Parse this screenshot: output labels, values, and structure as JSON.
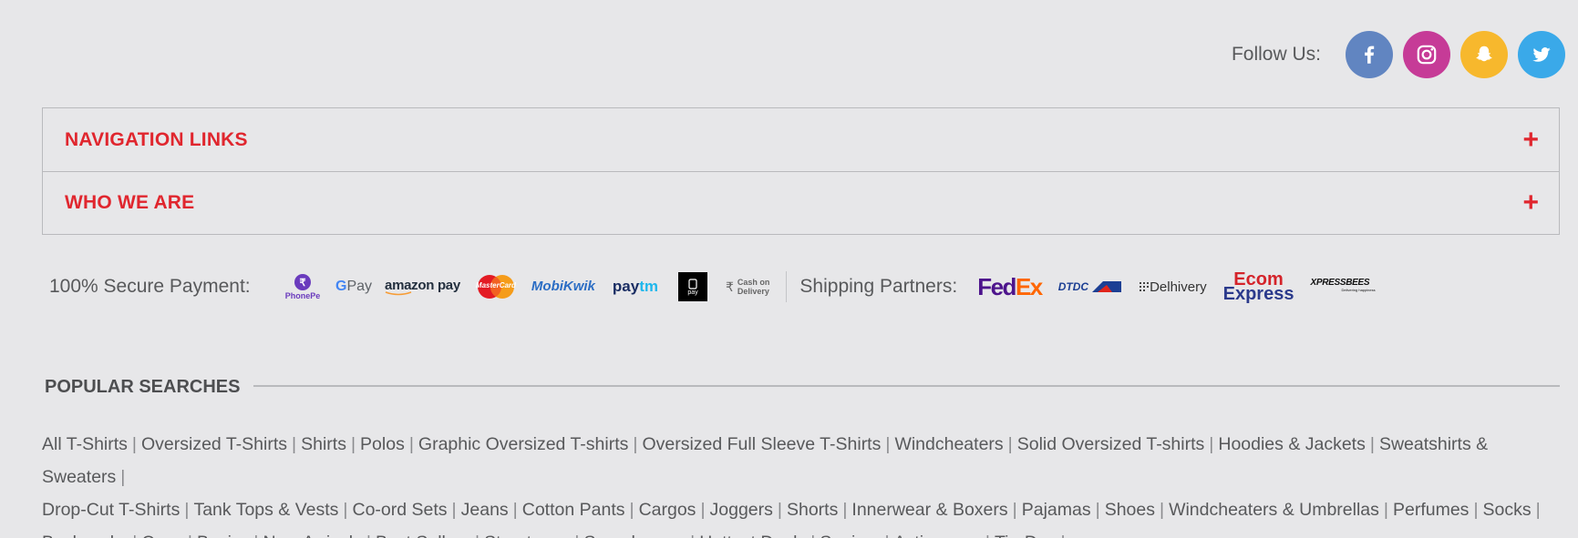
{
  "follow": {
    "label": "Follow Us:",
    "networks": [
      {
        "name": "facebook-icon",
        "color": "#6185c1"
      },
      {
        "name": "instagram-icon",
        "color": "#c63b97"
      },
      {
        "name": "snapchat-icon",
        "color": "#f7b82d"
      },
      {
        "name": "twitter-icon",
        "color": "#3aa9e9"
      }
    ]
  },
  "accordion": {
    "items": [
      {
        "label": "NAVIGATION LINKS"
      },
      {
        "label": "WHO WE ARE"
      }
    ],
    "expand_symbol": "+"
  },
  "payment": {
    "label": "100% Secure Payment:",
    "logos": {
      "phonepe": "PhonePe",
      "gpay_g": "G",
      "gpay": "Pay",
      "amazonpay": "amazon pay",
      "mastercard": "MasterCard",
      "mobikwik": "MobiKwik",
      "paytm_pay": "pay",
      "paytm_tm": "tm",
      "applepay": "pay",
      "cod_line1": "Cash on",
      "cod_line2": "Delivery"
    }
  },
  "shipping": {
    "label": "Shipping Partners:",
    "logos": {
      "fedex_fed": "Fed",
      "fedex_ex": "Ex",
      "dtdc": "DTDC",
      "delhivery": "Delhivery",
      "ecom1": "Ecom",
      "ecom2": "Express",
      "xpressbees": "XPRESSBEES",
      "xpressbees_tag": "Delivering happiness"
    }
  },
  "popular": {
    "title": "POPULAR SEARCHES",
    "separator": "|",
    "lines": [
      [
        "All T-Shirts",
        "Oversized T-Shirts",
        "Shirts",
        "Polos",
        "Graphic Oversized T-shirts",
        "Oversized Full Sleeve T-Shirts",
        "Windcheaters",
        "Solid Oversized T-shirts",
        "Hoodies & Jackets",
        "Sweatshirts & Sweaters"
      ],
      [
        "Drop-Cut T-Shirts",
        "Tank Tops & Vests",
        "Co-ord Sets",
        "Jeans",
        "Cotton Pants",
        "Cargos",
        "Joggers",
        "Shorts",
        "Innerwear & Boxers",
        "Pajamas",
        "Shoes",
        "Windcheaters & Umbrellas",
        "Perfumes",
        "Socks"
      ],
      [
        "Backpacks",
        "Caps",
        "Basics",
        "New Arrivals",
        "Best Sellers",
        "Streetwear",
        "Superheroes",
        "Hottest Deals",
        "Supima",
        "Activewear",
        "Tie-Dye"
      ]
    ]
  }
}
